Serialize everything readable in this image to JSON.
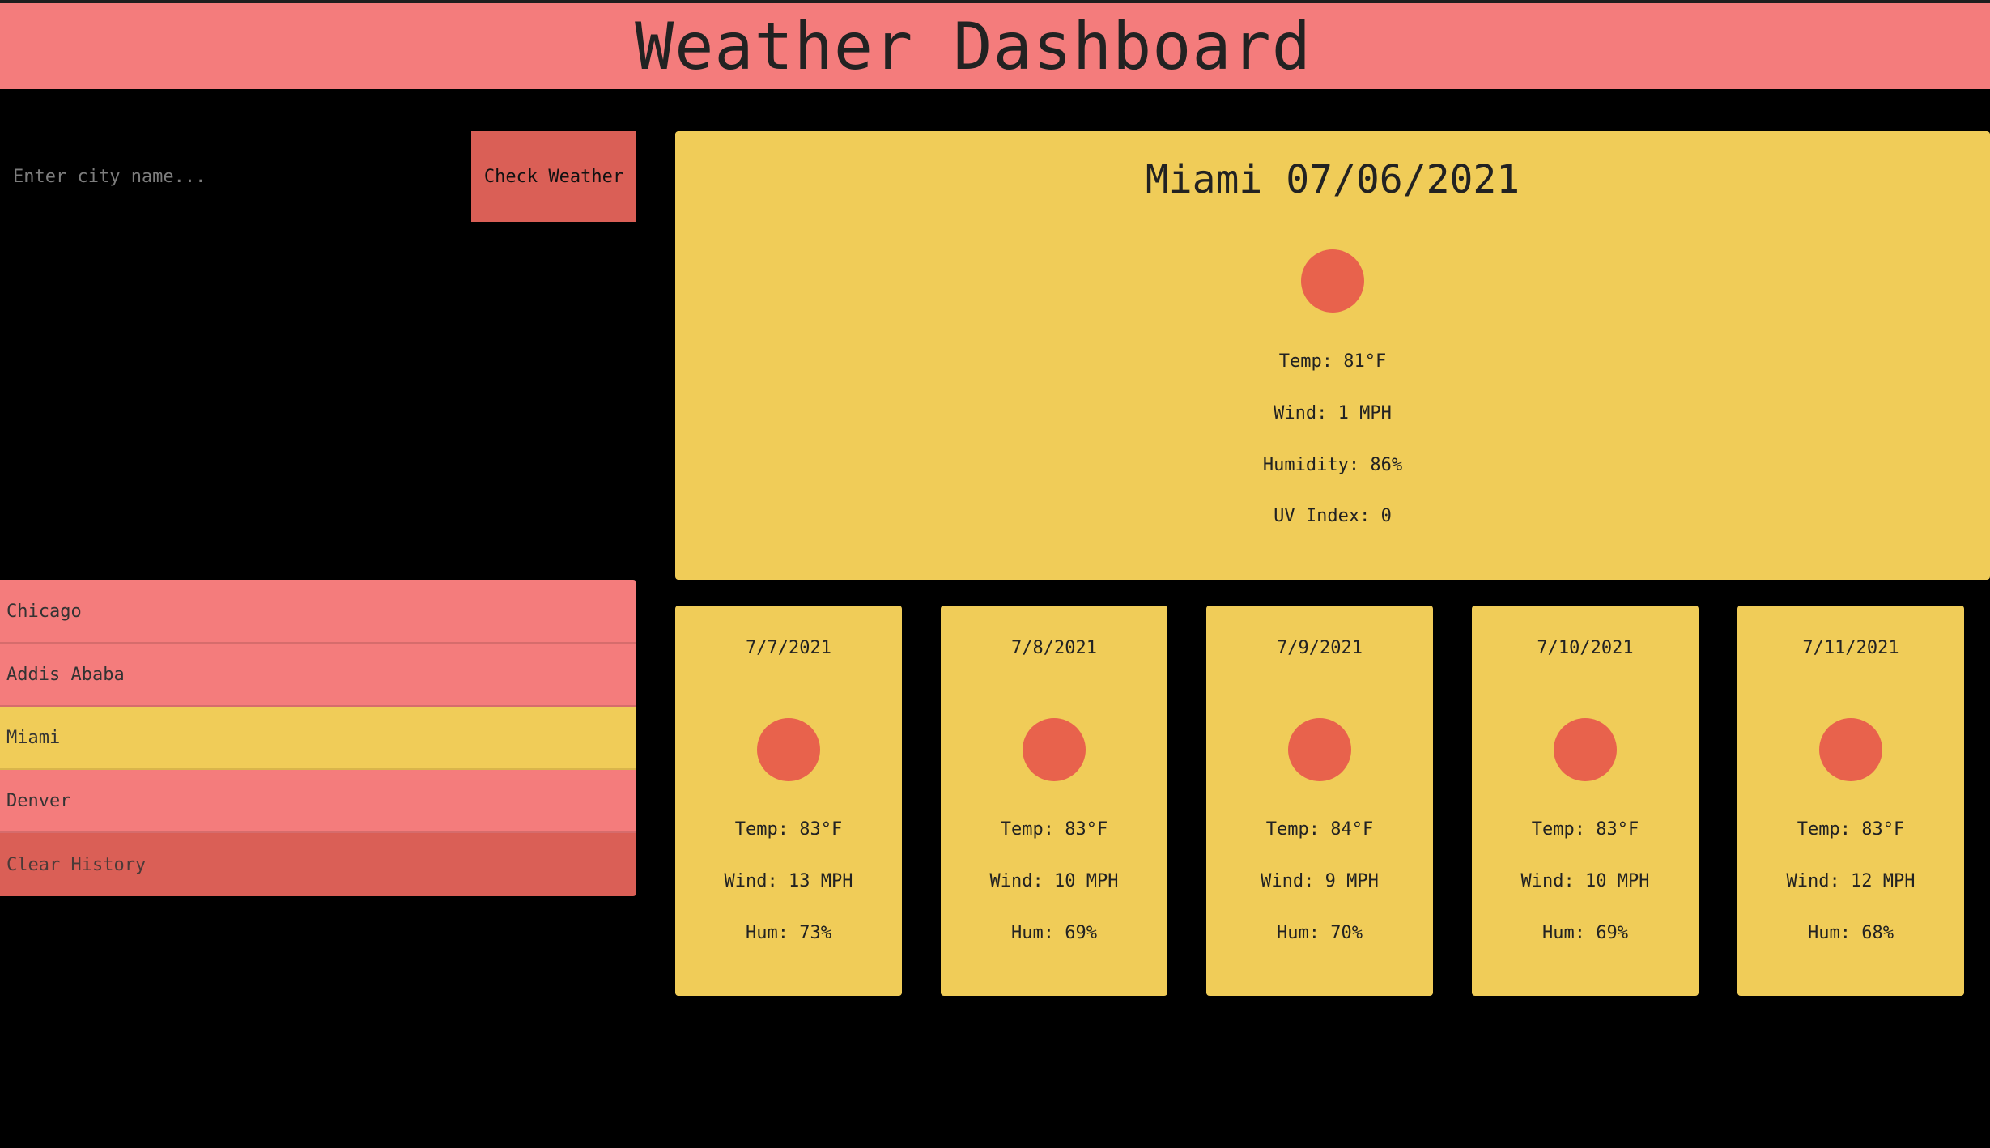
{
  "header": {
    "title": "Weather Dashboard"
  },
  "search": {
    "placeholder": "Enter city name...",
    "value": "",
    "button_label": "Check Weather"
  },
  "history": {
    "items": [
      {
        "label": "Chicago",
        "active": false
      },
      {
        "label": "Addis Ababa",
        "active": false
      },
      {
        "label": "Miami",
        "active": true
      },
      {
        "label": "Denver",
        "active": false
      }
    ],
    "clear_label": "Clear History"
  },
  "current": {
    "title": "Miami 07/06/2021",
    "icon": "sun-icon",
    "temp": "Temp: 81°F",
    "wind": "Wind: 1 MPH",
    "humidity": "Humidity: 86%",
    "uv": "UV Index: 0"
  },
  "forecast": [
    {
      "date": "7/7/2021",
      "icon": "sun-icon",
      "temp": "Temp: 83°F",
      "wind": "Wind: 13 MPH",
      "hum": "Hum: 73%"
    },
    {
      "date": "7/8/2021",
      "icon": "sun-icon",
      "temp": "Temp: 83°F",
      "wind": "Wind: 10 MPH",
      "hum": "Hum: 69%"
    },
    {
      "date": "7/9/2021",
      "icon": "sun-icon",
      "temp": "Temp: 84°F",
      "wind": "Wind: 9 MPH",
      "hum": "Hum: 70%"
    },
    {
      "date": "7/10/2021",
      "icon": "sun-icon",
      "temp": "Temp: 83°F",
      "wind": "Wind: 10 MPH",
      "hum": "Hum: 69%"
    },
    {
      "date": "7/11/2021",
      "icon": "sun-icon",
      "temp": "Temp: 83°F",
      "wind": "Wind: 12 MPH",
      "hum": "Hum: 68%"
    }
  ],
  "colors": {
    "header": "#f47c7c",
    "card": "#f0cc58",
    "button": "#da5f56",
    "sun": "#e8624c",
    "background": "#000000"
  }
}
